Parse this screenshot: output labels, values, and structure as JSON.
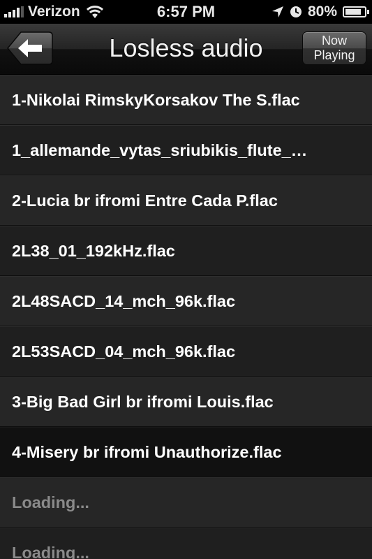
{
  "status_bar": {
    "carrier": "Verizon",
    "time": "6:57 PM",
    "battery_text": "80%",
    "battery_level": 0.8,
    "icons": [
      "signal-icon",
      "wifi-icon",
      "location-icon",
      "clock-icon",
      "battery-icon"
    ]
  },
  "nav": {
    "title": "Losless audio",
    "back_icon": "back-arrow-icon",
    "now_playing_line1": "Now",
    "now_playing_line2": "Playing"
  },
  "tracks": [
    {
      "label": "1-Nikolai RimskyKorsakov The S.flac"
    },
    {
      "label": "1_allemande_vytas_sriubikis_flute_…"
    },
    {
      "label": "2-Lucia br ifromi Entre Cada P.flac"
    },
    {
      "label": "2L38_01_192kHz.flac"
    },
    {
      "label": "2L48SACD_14_mch_96k.flac"
    },
    {
      "label": "2L53SACD_04_mch_96k.flac"
    },
    {
      "label": "3-Big Bad Girl br ifromi Louis.flac"
    },
    {
      "label": "4-Misery br ifromi Unauthorize.flac"
    },
    {
      "label": "Loading..."
    },
    {
      "label": "Loading..."
    }
  ],
  "colors": {
    "background": "#1c1c1c",
    "text": "#ffffff",
    "loading_text": "#8a8a8a"
  }
}
